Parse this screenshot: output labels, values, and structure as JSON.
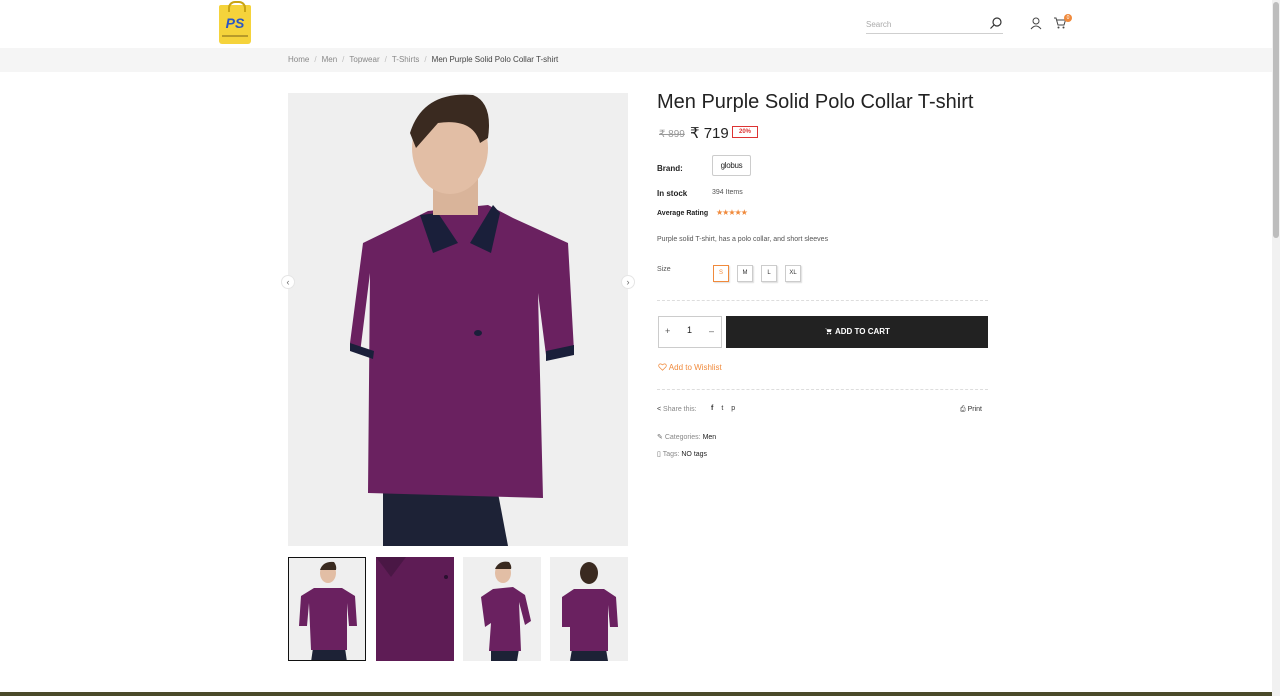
{
  "header": {
    "logo_text": "PS",
    "search_placeholder": "Search",
    "cart_count": "0"
  },
  "breadcrumb": {
    "items": [
      "Home",
      "Men",
      "Topwear",
      "T-Shirts"
    ],
    "current": "Men Purple Solid Polo Collar T-shirt",
    "separator": "/"
  },
  "gallery": {
    "prev_arrow": "‹",
    "next_arrow": "›"
  },
  "product": {
    "title": "Men Purple Solid Polo Collar T-shirt",
    "old_price": "₹ 899",
    "price": "₹ 719",
    "discount": "20%",
    "brand_label": "Brand:",
    "brand_name": "globus",
    "stock_label": "In stock",
    "stock_value": "394 Items",
    "rating_label": "Average Rating",
    "rating_stars": "★★★★★",
    "rating_value": 5,
    "description": "Purple solid T-shirt, has a polo collar, and short sleeves",
    "size_label": "Size",
    "sizes": [
      "S",
      "M",
      "L",
      "XL"
    ],
    "selected_size": "S",
    "quantity": "1",
    "qty_plus": "+",
    "qty_minus": "–",
    "add_to_cart": "ADD TO CART",
    "wishlist": "Add to Wishlist",
    "share_label": "Share this:",
    "print_label": "Print",
    "categories_label": "Categories:",
    "categories_value": "Men",
    "tags_label": "Tags:",
    "tags_value": "NO tags"
  },
  "colors": {
    "accent": "#f08a3c",
    "shirt": "#6a2160",
    "button": "#222222",
    "discount": "#dd3333"
  }
}
